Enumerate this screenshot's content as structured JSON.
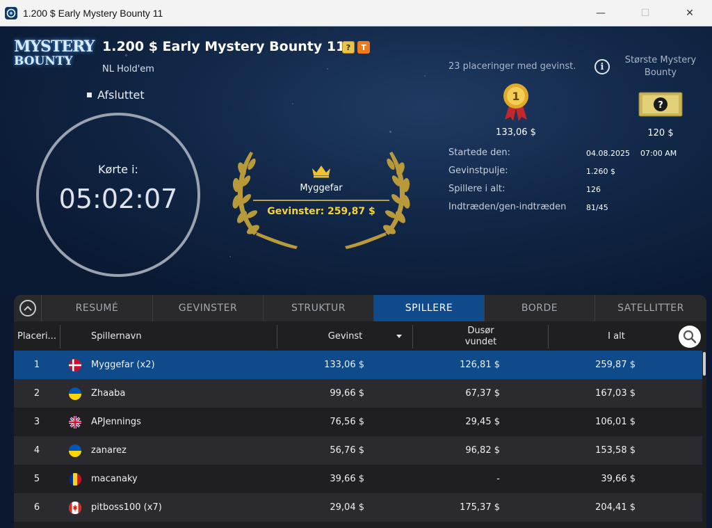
{
  "window": {
    "title": "1.200 $ Early Mystery Bounty 11",
    "minimize": "—",
    "maximize": "☐",
    "close": "✕"
  },
  "logo": {
    "line1": "MYSTERY",
    "line2": "BOUNTY"
  },
  "tournament": {
    "title": "1.200 $ Early Mystery Bounty 11",
    "badge_q": "?",
    "badge_t": "T",
    "game": "NL Hold'em",
    "status": "Afsluttet"
  },
  "timer": {
    "label": "Kørte i:",
    "value": "05:02:07"
  },
  "winner": {
    "name": "Myggefar",
    "prize": "Gevinster: 259,87 $"
  },
  "payout": {
    "places_text": "23 placeringer med gevinst.",
    "first_prize": "133,06 $",
    "medal_number": "1",
    "bounty_label": "Største Mystery Bounty",
    "bounty_value": "120 $"
  },
  "stats": [
    {
      "label": "Startede den:",
      "value": "04.08.2025",
      "value2": "07:00 AM"
    },
    {
      "label": "Gevinstpulje:",
      "value": "1.260 $",
      "value2": ""
    },
    {
      "label": "Spillere i alt:",
      "value": "126",
      "value2": ""
    },
    {
      "label": "Indtræden/gen-indtræden",
      "value": "81/45",
      "value2": ""
    }
  ],
  "tabs": [
    "RESUMÉ",
    "GEVINSTER",
    "STRUKTUR",
    "SPILLERE",
    "BORDE",
    "SATELLITTER"
  ],
  "active_tab": "SPILLERE",
  "columns": {
    "rank": "Placeri...",
    "name": "Spillernavn",
    "prize": "Gevinst",
    "bounty": "Dusør vundet",
    "total": "I alt"
  },
  "rows": [
    {
      "rank": "1",
      "flag": "dk",
      "name": "Myggefar (x2)",
      "prize": "133,06 $",
      "bounty": "126,81 $",
      "total": "259,87 $"
    },
    {
      "rank": "2",
      "flag": "ua",
      "name": "Zhaaba",
      "prize": "99,66 $",
      "bounty": "67,37 $",
      "total": "167,03 $"
    },
    {
      "rank": "3",
      "flag": "gb",
      "name": "APJennings",
      "prize": "76,56 $",
      "bounty": "29,45 $",
      "total": "106,01 $"
    },
    {
      "rank": "4",
      "flag": "ua",
      "name": "zanarez",
      "prize": "56,76 $",
      "bounty": "96,82 $",
      "total": "153,58 $"
    },
    {
      "rank": "5",
      "flag": "ro",
      "name": "macanaky",
      "prize": "39,66 $",
      "bounty": "-",
      "total": "39,66 $"
    },
    {
      "rank": "6",
      "flag": "ca",
      "name": "pitboss100 (x7)",
      "prize": "29,04 $",
      "bounty": "175,37 $",
      "total": "204,41 $"
    }
  ],
  "colors": {
    "accent": "#0f4a8a",
    "gold": "#f5d33b",
    "panel": "#1f1f22"
  }
}
